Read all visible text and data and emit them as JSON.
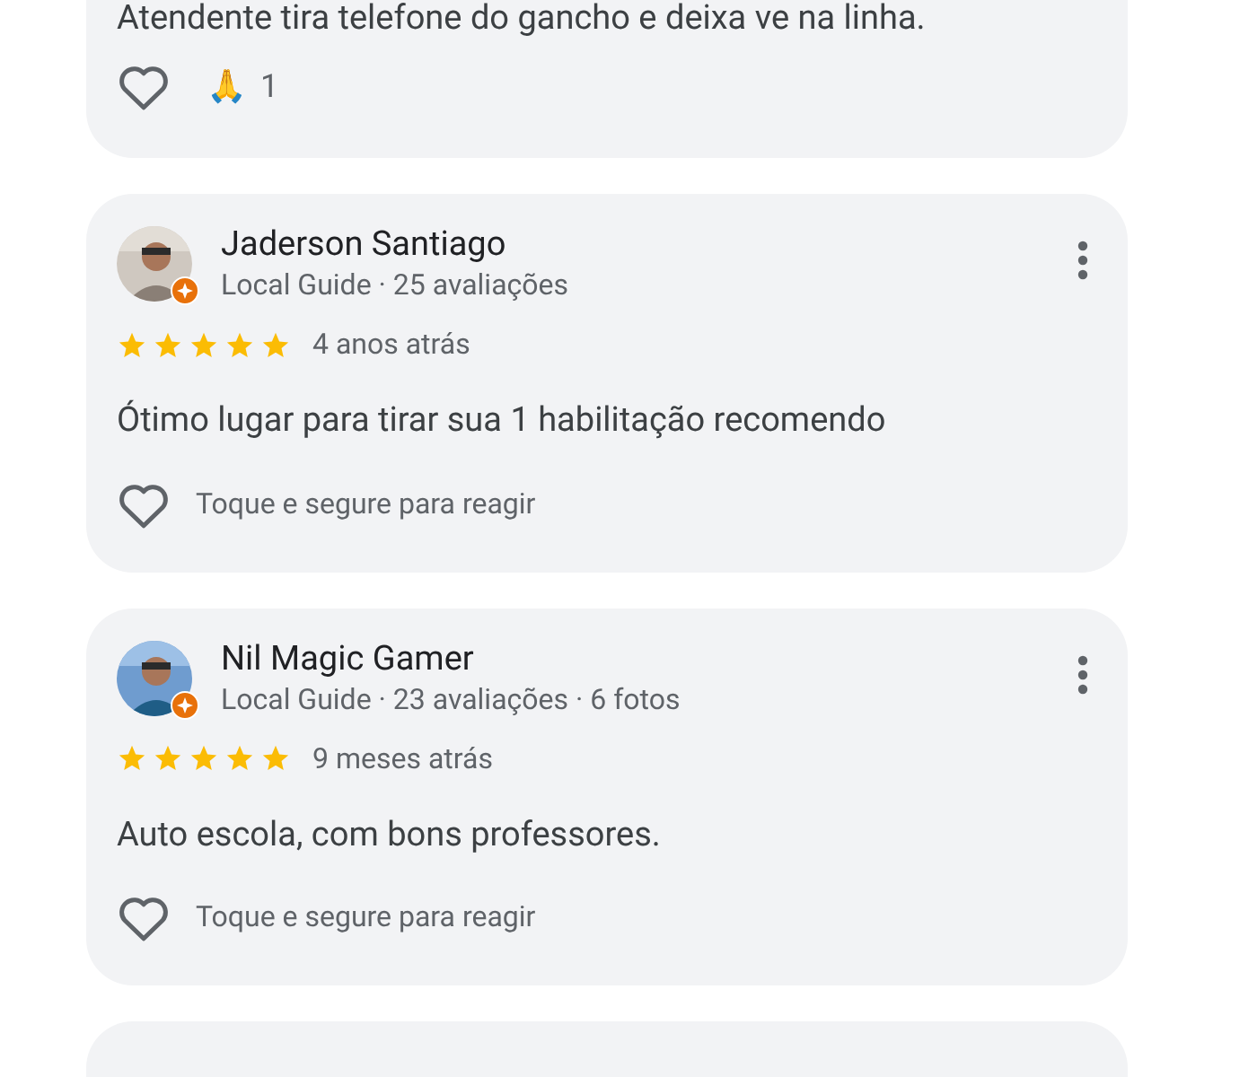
{
  "top_review": {
    "text": "Atendente tira telefone do gancho e deixa ve na linha.",
    "reaction_emoji": "🙏",
    "reaction_count": "1"
  },
  "reviews": [
    {
      "name": "Jaderson Santiago",
      "meta": "Local Guide · 25 avaliações",
      "stars": 5,
      "time": "4 anos atrás",
      "text": "Ótimo lugar para tirar sua 1 habilitação recomendo",
      "reaction_hint": "Toque e segure para reagir"
    },
    {
      "name": "Nil Magic Gamer",
      "meta": "Local Guide · 23 avaliações · 6 fotos",
      "stars": 5,
      "time": "9 meses atrás",
      "text": "Auto escola, com bons professores.",
      "reaction_hint": "Toque e segure para reagir"
    }
  ]
}
